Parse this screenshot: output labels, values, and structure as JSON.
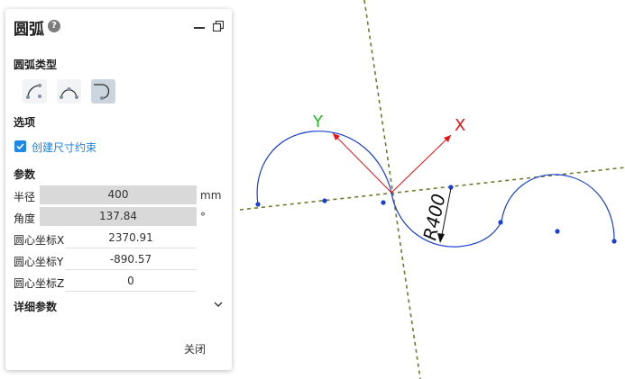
{
  "panel": {
    "title": "圆弧",
    "help_glyph": "?",
    "arc_type_label": "圆弧类型",
    "arc_types": [
      {
        "icon": "three-point-arc-icon",
        "active": false
      },
      {
        "icon": "center-arc-icon",
        "active": false
      },
      {
        "icon": "tangent-arc-icon",
        "active": true
      }
    ],
    "options_label": "选项",
    "create_dimension_constraint": {
      "label": "创建尺寸约束",
      "checked": true
    },
    "params_label": "参数",
    "params": {
      "radius": {
        "label": "半径",
        "value": "400",
        "unit": "mm"
      },
      "angle": {
        "label": "角度",
        "value": "137.84",
        "unit": "°"
      },
      "center_x": {
        "label": "圆心坐标X",
        "value": "2370.91"
      },
      "center_y": {
        "label": "圆心坐标Y",
        "value": "-890.57"
      },
      "center_z": {
        "label": "圆心坐标Z",
        "value": "0"
      }
    },
    "details_label": "详细参数",
    "close_label": "关闭"
  },
  "viewport": {
    "axis_x_label": "X",
    "axis_y_label": "Y",
    "dimension_text": "R400",
    "colors": {
      "axis_x": "#ee1111",
      "axis_y": "#22bb22",
      "arc": "#1a3fd6",
      "guide": "#6d7a2a",
      "point": "#1a3fd6"
    }
  }
}
